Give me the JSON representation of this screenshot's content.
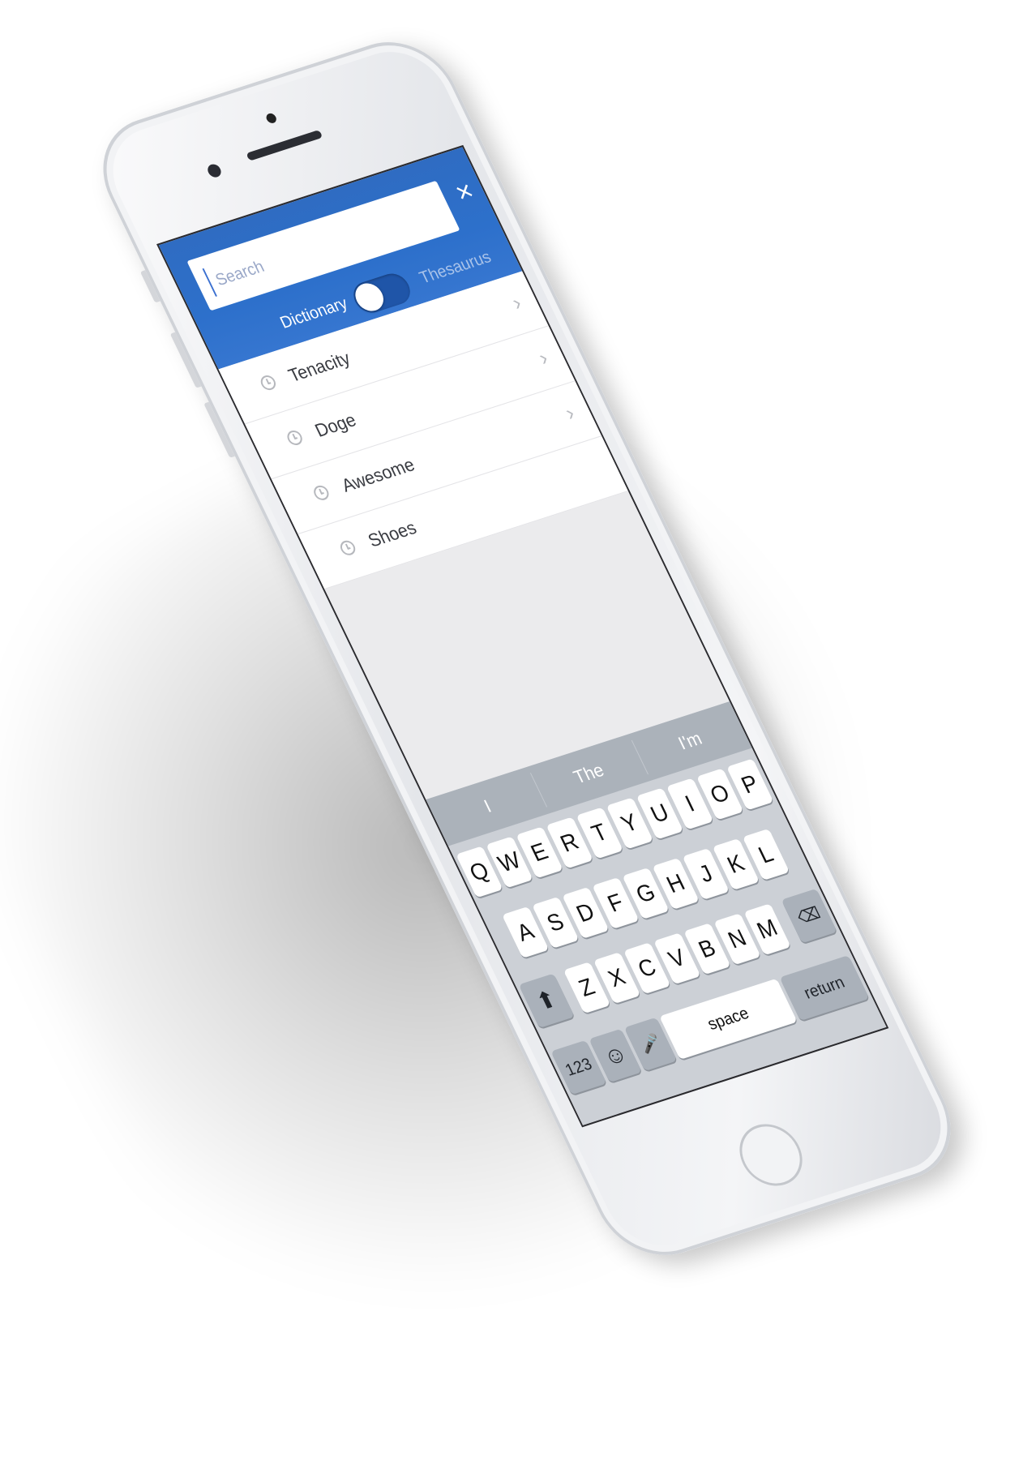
{
  "search": {
    "placeholder": "Search",
    "close_icon": "×"
  },
  "mode_toggle": {
    "left_label": "Dictionary",
    "right_label": "Thesaurus"
  },
  "recent_searches": [
    {
      "label": "Tenacity",
      "icon": "clock-icon"
    },
    {
      "label": "Doge",
      "icon": "clock-icon"
    },
    {
      "label": "Awesome",
      "icon": "clock-icon"
    },
    {
      "label": "Shoes",
      "icon": "clock-icon"
    }
  ],
  "chevron": "›",
  "keyboard": {
    "suggestions": [
      "I",
      "The",
      "I'm"
    ],
    "row1": [
      "Q",
      "W",
      "E",
      "R",
      "T",
      "Y",
      "U",
      "I",
      "O",
      "P"
    ],
    "row2": [
      "A",
      "S",
      "D",
      "F",
      "G",
      "H",
      "J",
      "K",
      "L"
    ],
    "row3": [
      "Z",
      "X",
      "C",
      "V",
      "B",
      "N",
      "M"
    ],
    "shift": "⬆",
    "delete": "⌫",
    "numbers": "123",
    "emoji": "☺",
    "mic": "🎤",
    "space": "space",
    "return": "return"
  },
  "colors": {
    "header": "#2f6cc2",
    "switch_track": "#1f55a8",
    "keyboard": "#ccd0d6",
    "suggestion_bar": "#abb2ba"
  }
}
